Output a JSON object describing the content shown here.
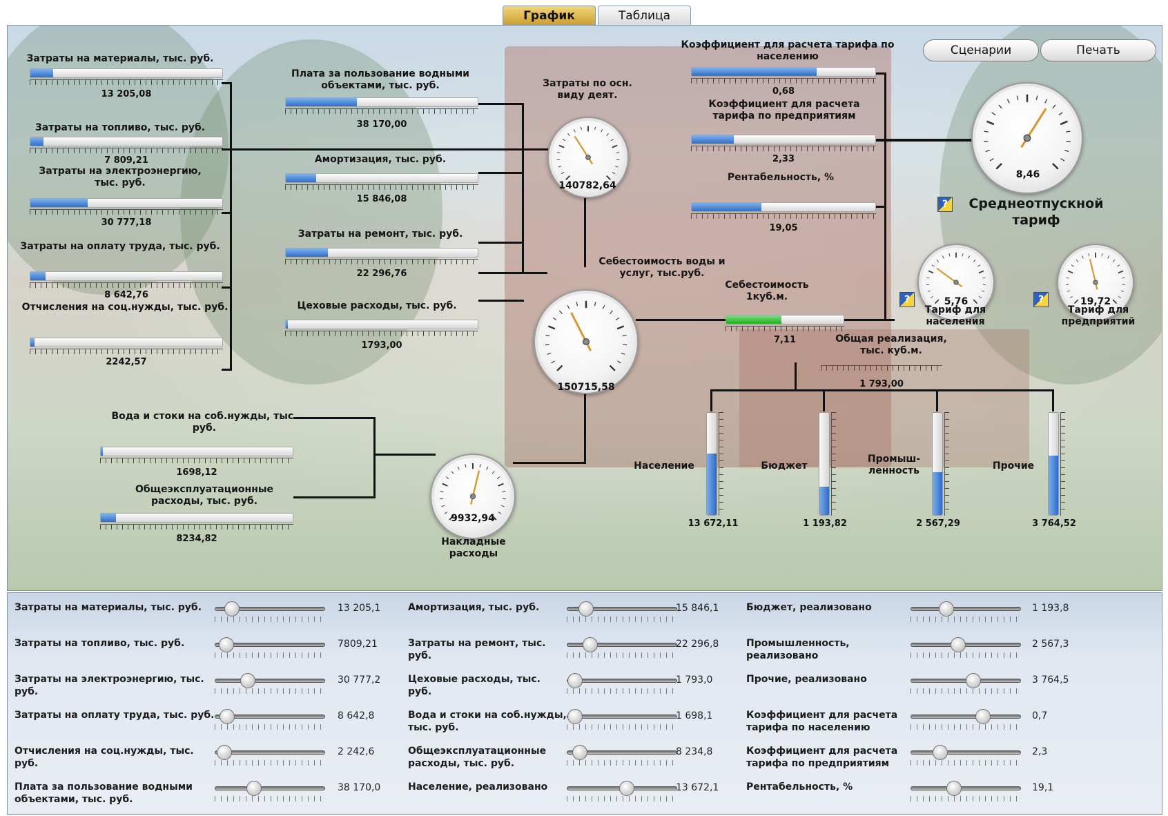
{
  "tabs": {
    "graph": "График",
    "table": "Таблица"
  },
  "buttons": {
    "scenarios": "Сценарии",
    "print": "Печать"
  },
  "left_inputs": [
    {
      "label": "Затраты на материалы, тыс. руб.",
      "value": "13 205,08",
      "level": 0.12
    },
    {
      "label": "Затраты на топливо, тыс. руб.",
      "value": "7 809,21",
      "level": 0.07
    },
    {
      "label": "Затраты на электроэнергию, тыс. руб.",
      "value": "30 777,18",
      "level": 0.3
    },
    {
      "label": "Затраты на оплату труда, тыс. руб.",
      "value": "8 642,76",
      "level": 0.08
    },
    {
      "label": "Отчисления на соц.нужды, тыс. руб.",
      "value": "2242,57",
      "level": 0.02
    }
  ],
  "mid_inputs": [
    {
      "label": "Плата за пользование водными объектами, тыс. руб.",
      "value": "38 170,00",
      "level": 0.37
    },
    {
      "label": "Амортизация, тыс. руб.",
      "value": "15 846,08",
      "level": 0.16
    },
    {
      "label": "Затраты на ремонт, тыс. руб.",
      "value": "22 296,76",
      "level": 0.22
    },
    {
      "label": "Цеховые расходы, тыс. руб.",
      "value": "1793,00",
      "level": 0.01
    }
  ],
  "overhead_inputs": [
    {
      "label": "Вода и стоки на соб.нужды, тыс. руб.",
      "value": "1698,12",
      "level": 0.01
    },
    {
      "label": "Общеэксплуатационные расходы, тыс. руб.",
      "value": "8234,82",
      "level": 0.08
    }
  ],
  "right_inputs": [
    {
      "label": "Коэффициент для расчета тарифа по населению",
      "value": "0,68",
      "level": 0.68
    },
    {
      "label": "Коэффициент для расчета тарифа по предприятиям",
      "value": "2,33",
      "level": 0.23
    },
    {
      "label": "Рентабельность, %",
      "value": "19,05",
      "level": 0.38
    }
  ],
  "dials": {
    "main_activity": {
      "label": "Затраты по осн. виду деят.",
      "value": "140782,64",
      "level": 0.38
    },
    "cost_water": {
      "label": "Себестоимость воды и услуг, тыс.руб.",
      "value": "150715,58",
      "level": 0.4
    },
    "overhead": {
      "label": "Накладные расходы",
      "value": "9932,94",
      "level": 0.55
    },
    "avg_tariff": {
      "label": "Среднеотпускной тариф",
      "value": "8,46",
      "level": 0.62
    },
    "tariff_pop": {
      "label": "Тариф для населения",
      "value": "5,76",
      "level": 0.3
    },
    "tariff_ent": {
      "label": "Тариф для предприятий",
      "value": "19,72",
      "level": 0.45
    }
  },
  "cost_per_m3": {
    "label": "Себестоимость 1куб.м.",
    "value": "7,11",
    "level": 0.47
  },
  "total_sales": {
    "label": "Общая реализация, тыс. куб.м.",
    "value": "1 793,00"
  },
  "consumers": [
    {
      "label": "Население",
      "value": "13 672,11",
      "level": 0.6
    },
    {
      "label": "Бюджет",
      "value": "1 193,82",
      "level": 0.28
    },
    {
      "label": "Промыш- ленность",
      "value": "2 567,29",
      "level": 0.42
    },
    {
      "label": "Прочие",
      "value": "3 764,52",
      "level": 0.58
    }
  ],
  "sliders": [
    [
      {
        "label": "Затраты на материалы, тыс. руб.",
        "value": "13 205,1",
        "level": 0.1
      },
      {
        "label": "Затраты на топливо, тыс. руб.",
        "value": "7809,21",
        "level": 0.04
      },
      {
        "label": "Затраты на электроэнергию, тыс. руб.",
        "value": "30 777,2",
        "level": 0.27
      },
      {
        "label": "Затраты на оплату труда, тыс. руб.",
        "value": "8 642,8",
        "level": 0.05
      },
      {
        "label": "Отчисления на соц.нужды, тыс. руб.",
        "value": "2 242,6",
        "level": 0.02
      },
      {
        "label": "Плата за пользование водными объектами, тыс. руб.",
        "value": "38 170,0",
        "level": 0.33
      }
    ],
    [
      {
        "label": "Амортизация, тыс. руб.",
        "value": "15 846,1",
        "level": 0.12
      },
      {
        "label": "Затраты на ремонт, тыс. руб.",
        "value": "22 296,8",
        "level": 0.17
      },
      {
        "label": "Цеховые расходы, тыс. руб.",
        "value": "1 793,0",
        "level": 0.01
      },
      {
        "label": "Вода и стоки на соб.нужды, тыс. руб.",
        "value": "1 698,1",
        "level": 0.01
      },
      {
        "label": "Общеэксплуатационные расходы, тыс. руб.",
        "value": "8 234,8",
        "level": 0.06
      },
      {
        "label": "Население, реализовано",
        "value": "13 672,1",
        "level": 0.55
      }
    ],
    [
      {
        "label": "Бюджет, реализовано",
        "value": "1 193,8",
        "level": 0.3
      },
      {
        "label": "Промышленность, реализовано",
        "value": "2 567,3",
        "level": 0.42
      },
      {
        "label": "Прочие, реализовано",
        "value": "3 764,5",
        "level": 0.58
      },
      {
        "label": "Коэффициент для расчета тарифа по населению",
        "value": "0,7",
        "level": 0.68
      },
      {
        "label": "Коэффициент для расчета тарифа по предприятиям",
        "value": "2,3",
        "level": 0.23
      },
      {
        "label": "Рентабельность, %",
        "value": "19,1",
        "level": 0.38
      }
    ]
  ]
}
